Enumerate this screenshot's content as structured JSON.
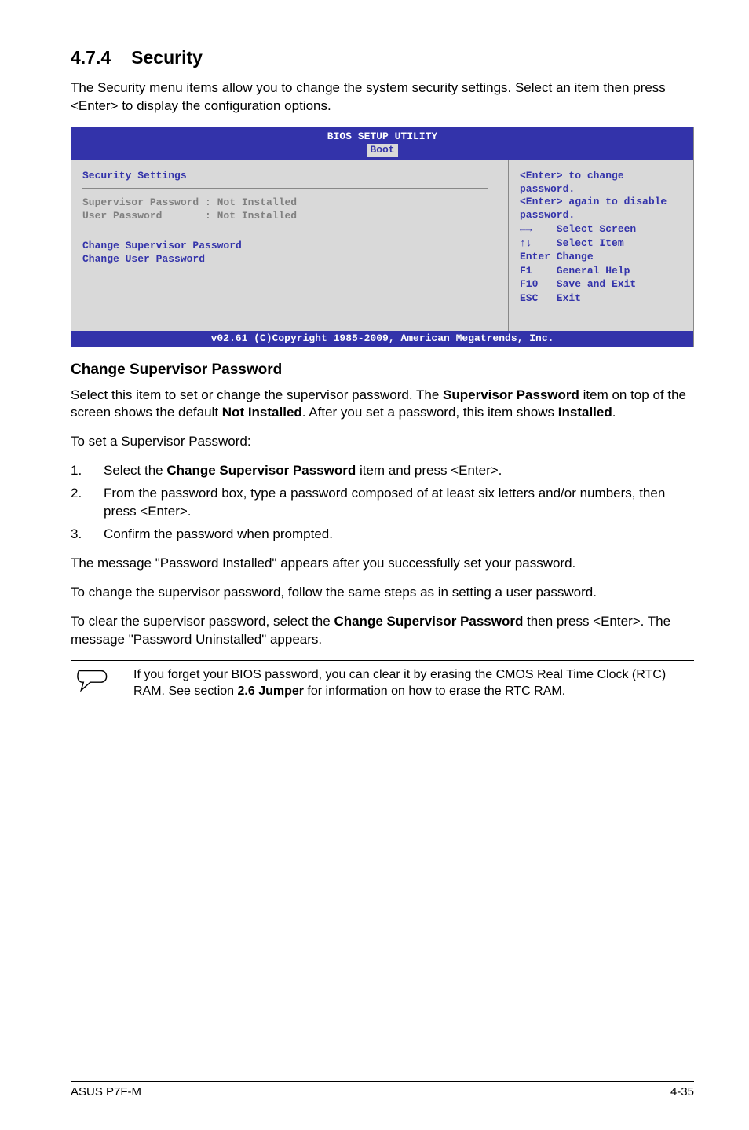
{
  "section": {
    "number": "4.7.4",
    "title": "Security"
  },
  "intro": "The Security menu items allow you to change the system security settings. Select an item then press <Enter> to display the configuration options.",
  "bios": {
    "header_title": "BIOS SETUP UTILITY",
    "header_tab": "Boot",
    "left": {
      "title": "Security Settings",
      "sup_label": "Supervisor Password : Not Installed",
      "user_label": "User Password       : Not Installed",
      "change_sup": "Change Supervisor Password",
      "change_user": "Change User Password"
    },
    "right": {
      "help1": "<Enter> to change password.",
      "help2": "<Enter> again to disable password.",
      "nav1": "←→    Select Screen",
      "nav2": "↑↓    Select Item",
      "nav3": "Enter Change",
      "nav4": "F1    General Help",
      "nav5": "F10   Save and Exit",
      "nav6": "ESC   Exit"
    },
    "footer": "v02.61 (C)Copyright 1985-2009, American Megatrends, Inc."
  },
  "subheading": "Change Supervisor Password",
  "para1_a": "Select this item to set or change the supervisor password. The ",
  "para1_b": "Supervisor Password",
  "para1_c": " item on top of the screen shows the default ",
  "para1_d": "Not Installed",
  "para1_e": ". After you set a password, this item shows ",
  "para1_f": "Installed",
  "para1_g": ".",
  "para2": "To set a Supervisor Password:",
  "steps": {
    "s1_a": "Select the ",
    "s1_b": "Change Supervisor Password",
    "s1_c": " item and press <Enter>.",
    "s2": "From the password box, type a password composed of at least six letters and/or numbers, then press <Enter>.",
    "s3": "Confirm the password when prompted."
  },
  "para3": "The message \"Password Installed\" appears after you successfully set your password.",
  "para4": "To change the supervisor password, follow the same steps as in setting a user password.",
  "para5_a": "To clear the supervisor password, select the ",
  "para5_b": "Change Supervisor Password",
  "para5_c": " then press <Enter>. The message \"Password Uninstalled\" appears.",
  "note_a": "If you forget your BIOS password, you can clear it by erasing the CMOS Real Time Clock (RTC) RAM. See section ",
  "note_b": "2.6 Jumper",
  "note_c": " for information on how to erase the RTC RAM.",
  "footer": {
    "left": "ASUS P7F-M",
    "right": "4-35"
  }
}
